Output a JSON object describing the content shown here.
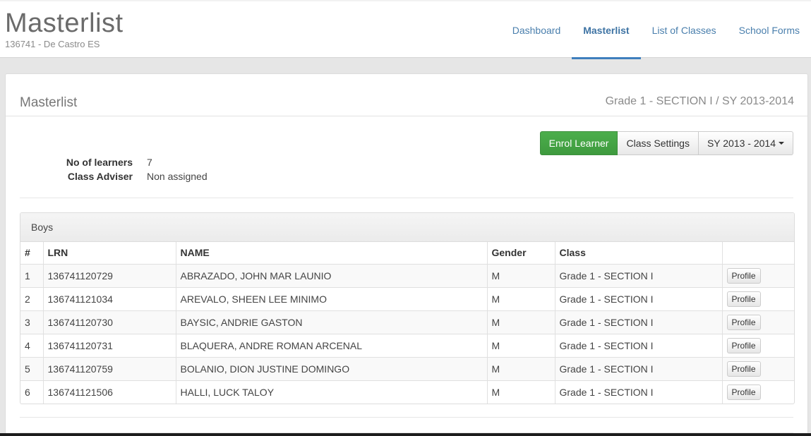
{
  "header": {
    "title": "Masterlist",
    "subtitle": "136741 - De Castro ES"
  },
  "nav": [
    {
      "label": "Dashboard",
      "active": false
    },
    {
      "label": "Masterlist",
      "active": true
    },
    {
      "label": "List of Classes",
      "active": false
    },
    {
      "label": "School Forms",
      "active": false
    }
  ],
  "panel": {
    "title": "Masterlist",
    "context": "Grade 1 - SECTION I / SY 2013-2014",
    "buttons": {
      "enrol": "Enrol Learner",
      "settings": "Class Settings",
      "school_year": "SY 2013 - 2014"
    },
    "info": [
      {
        "label": "No of learners",
        "value": "7"
      },
      {
        "label": "Class Adviser",
        "value": "Non assigned"
      }
    ],
    "accent_color": "#449d44"
  },
  "boys": {
    "heading": "Boys",
    "columns": [
      "#",
      "LRN",
      "NAME",
      "Gender",
      "Class",
      ""
    ],
    "action_label": "Profile",
    "rows": [
      {
        "num": "1",
        "lrn": "136741120729",
        "name": "ABRAZADO, JOHN MAR LAUNIO",
        "gender": "M",
        "class": "Grade 1 - SECTION I"
      },
      {
        "num": "2",
        "lrn": "136741121034",
        "name": "AREVALO, SHEEN LEE MINIMO",
        "gender": "M",
        "class": "Grade 1 - SECTION I"
      },
      {
        "num": "3",
        "lrn": "136741120730",
        "name": "BAYSIC, ANDRIE GASTON",
        "gender": "M",
        "class": "Grade 1 - SECTION I"
      },
      {
        "num": "4",
        "lrn": "136741120731",
        "name": "BLAQUERA, ANDRE ROMAN ARCENAL",
        "gender": "M",
        "class": "Grade 1 - SECTION I"
      },
      {
        "num": "5",
        "lrn": "136741120759",
        "name": "BOLANIO, DION JUSTINE DOMINGO",
        "gender": "M",
        "class": "Grade 1 - SECTION I"
      },
      {
        "num": "6",
        "lrn": "136741121506",
        "name": "HALLI, LUCK TALOY",
        "gender": "M",
        "class": "Grade 1 - SECTION I"
      }
    ]
  }
}
